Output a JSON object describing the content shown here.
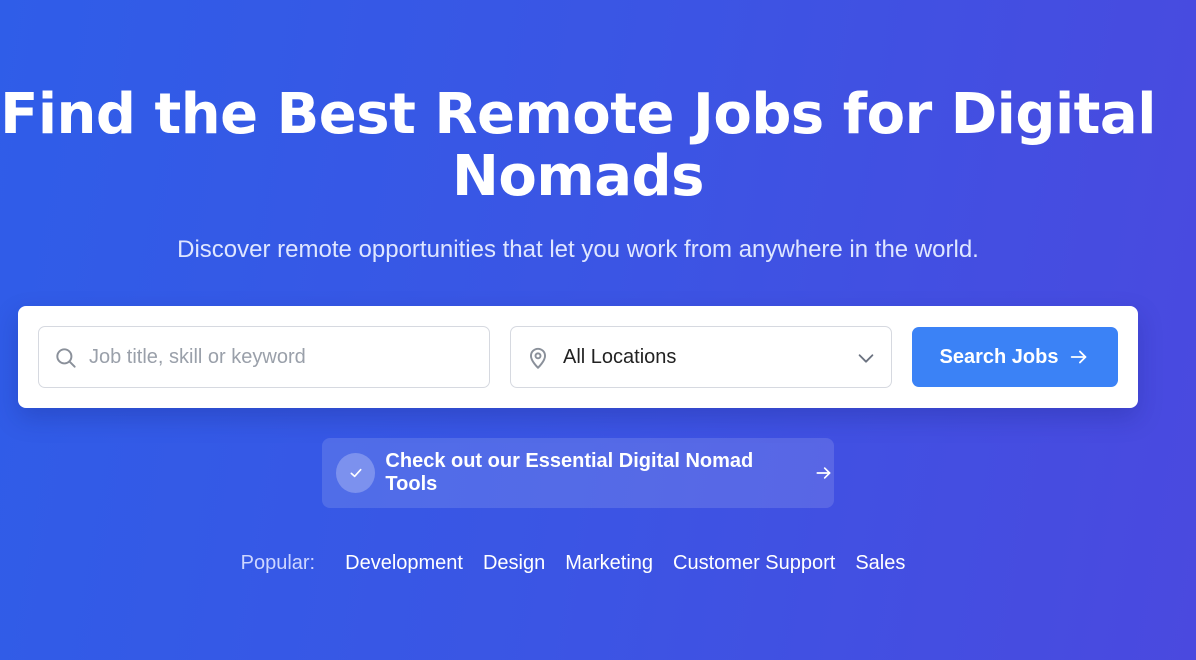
{
  "hero": {
    "title": "Find the Best Remote Jobs for Digital Nomads",
    "subtitle": "Discover remote opportunities that let you work from anywhere in the world."
  },
  "search": {
    "keyword_placeholder": "Job title, skill or keyword",
    "keyword_icon": "search-icon",
    "location_value": "All Locations",
    "location_icon": "map-pin-icon",
    "location_dropdown_icon": "chevron-down-icon",
    "button_label": "Search Jobs",
    "button_icon": "arrow-right-icon",
    "button_color": "#3b82f6"
  },
  "tools_banner": {
    "label": "Check out our Essential Digital Nomad Tools",
    "leading_icon": "check-icon",
    "trailing_icon": "arrow-right-icon"
  },
  "popular": {
    "label": "Popular:",
    "links": [
      "Development",
      "Design",
      "Marketing",
      "Customer Support",
      "Sales"
    ]
  }
}
